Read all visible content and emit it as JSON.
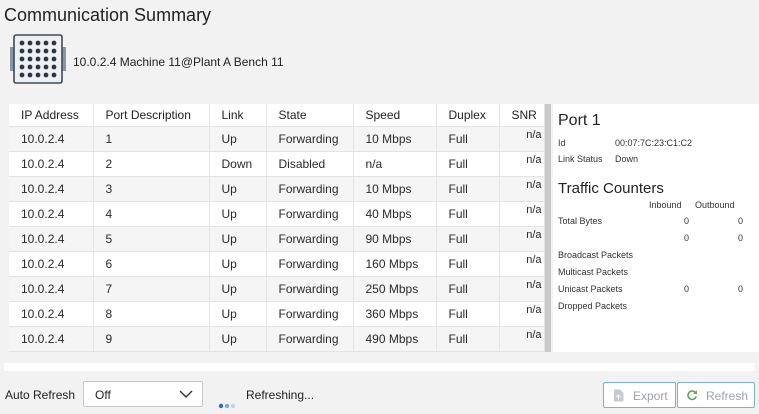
{
  "page": {
    "title": "Communication Summary"
  },
  "device": {
    "name": "10.0.2.4 Machine 11@Plant A Bench 11",
    "icon": "network-switch-icon"
  },
  "ports_table": {
    "columns": [
      "IP Address",
      "Port Description",
      "Link",
      "State",
      "Speed",
      "Duplex",
      "SNR"
    ],
    "rows": [
      [
        "10.0.2.4",
        "1",
        "Up",
        "Forwarding",
        "10 Mbps",
        "Full",
        "n/a"
      ],
      [
        "10.0.2.4",
        "2",
        "Down",
        "Disabled",
        "n/a",
        "Full",
        "n/a"
      ],
      [
        "10.0.2.4",
        "3",
        "Up",
        "Forwarding",
        "10 Mbps",
        "Full",
        "n/a"
      ],
      [
        "10.0.2.4",
        "4",
        "Up",
        "Forwarding",
        "40 Mbps",
        "Full",
        "n/a"
      ],
      [
        "10.0.2.4",
        "5",
        "Up",
        "Forwarding",
        "90 Mbps",
        "Full",
        "n/a"
      ],
      [
        "10.0.2.4",
        "6",
        "Up",
        "Forwarding",
        "160 Mbps",
        "Full",
        "n/a"
      ],
      [
        "10.0.2.4",
        "7",
        "Up",
        "Forwarding",
        "250 Mbps",
        "Full",
        "n/a"
      ],
      [
        "10.0.2.4",
        "8",
        "Up",
        "Forwarding",
        "360 Mbps",
        "Full",
        "n/a"
      ],
      [
        "10.0.2.4",
        "9",
        "Up",
        "Forwarding",
        "490 Mbps",
        "Full",
        "n/a"
      ]
    ]
  },
  "port_detail": {
    "title": "Port 1",
    "id_label": "Id",
    "id_value": "00:07:7C:23:C1:C2",
    "link_status_label": "Link Status",
    "link_status_value": "Down"
  },
  "traffic": {
    "title": "Traffic Counters",
    "inbound_label": "Inbound",
    "outbound_label": "Outbound",
    "total_bytes_label": "Total Bytes",
    "total_bytes_in": "0",
    "total_bytes_out": "0",
    "second_row_in": "0",
    "second_row_out": "0",
    "broadcast_label": "Broadcast Packets",
    "multicast_label": "Multicast Packets",
    "unicast_label": "Unicast Packets",
    "unicast_in": "0",
    "unicast_out": "0",
    "dropped_label": "Dropped Packets"
  },
  "footer": {
    "auto_refresh_label": "Auto Refresh",
    "auto_refresh_value": "Off",
    "status_text": "Refreshing...",
    "export_label": "Export",
    "refresh_label": "Refresh"
  },
  "colors": {
    "button_border": "#7fb2c9",
    "button_text": "#9aa3a8",
    "spinner_dot": "#3a7bc8"
  }
}
